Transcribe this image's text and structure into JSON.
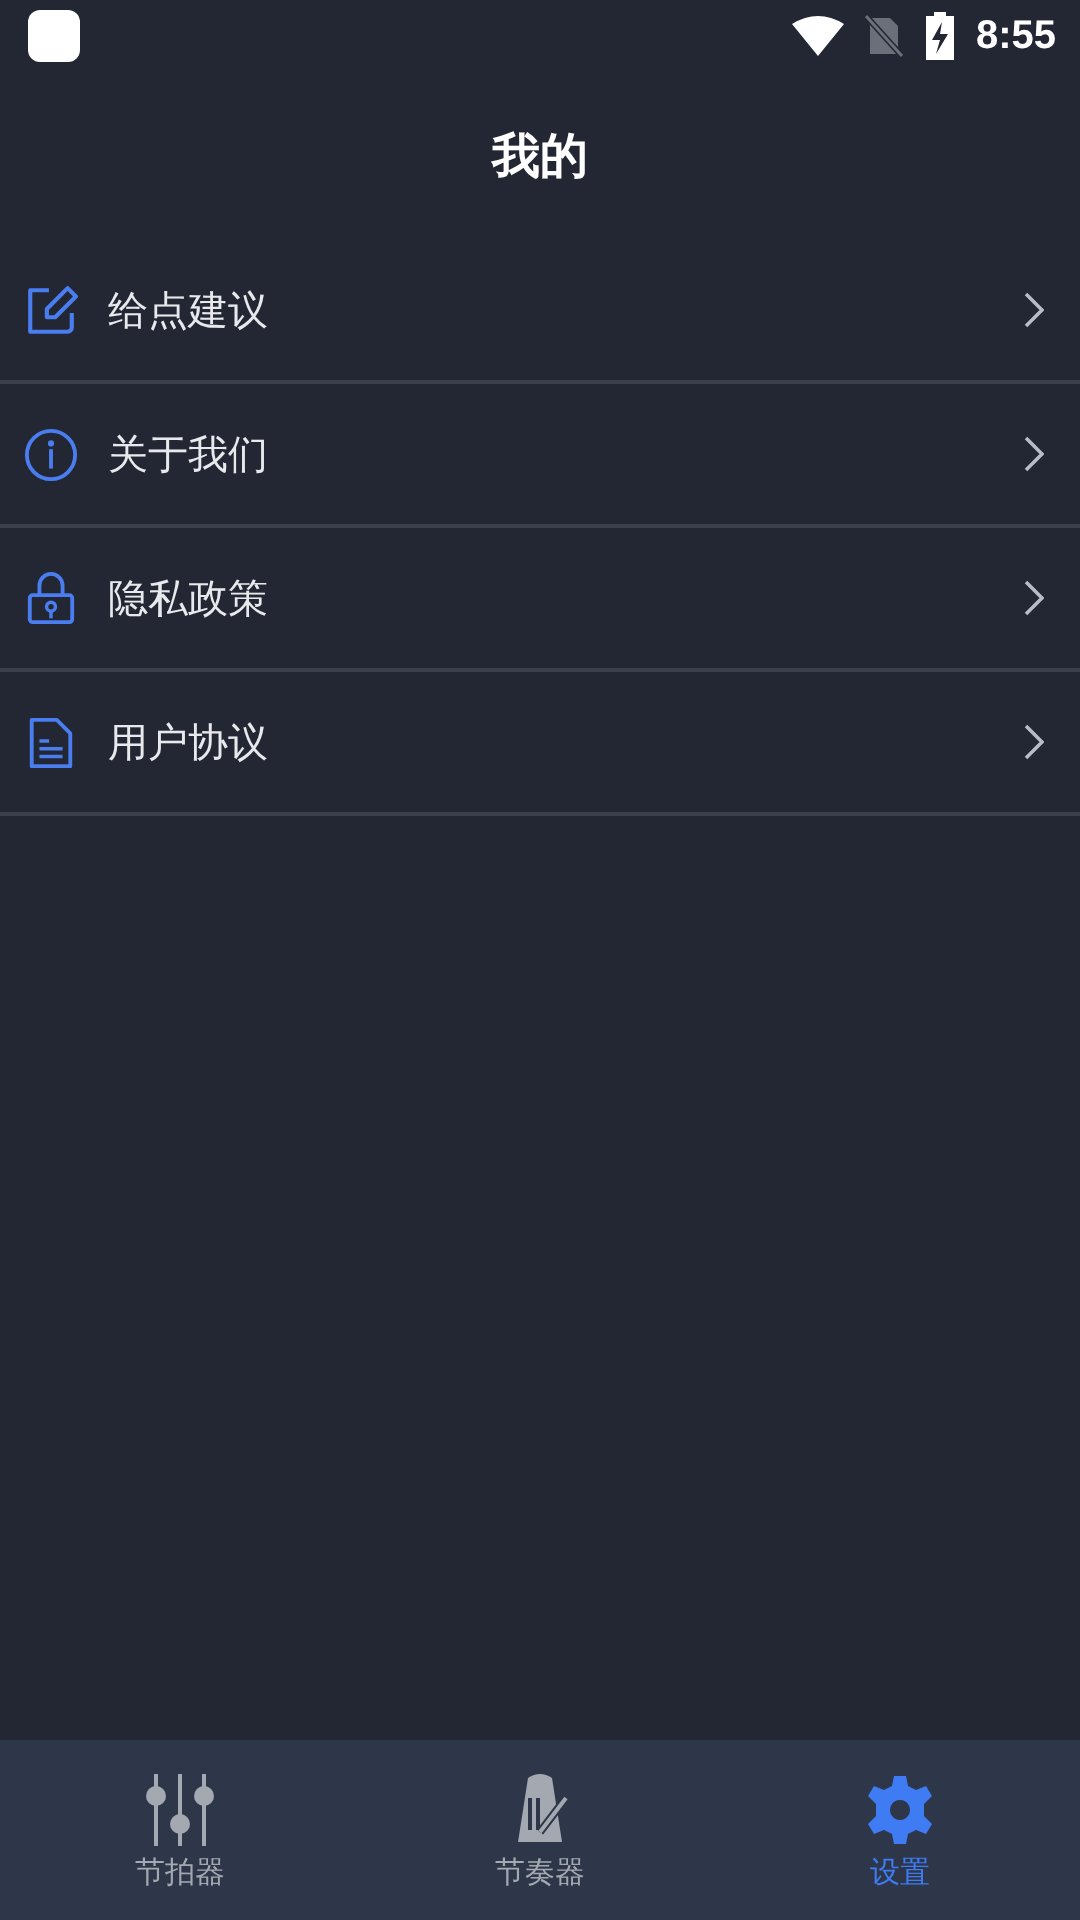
{
  "status_bar": {
    "time": "8:55"
  },
  "header": {
    "title": "我的"
  },
  "menu_items": [
    {
      "kind": "edit",
      "label": "给点建议"
    },
    {
      "kind": "info",
      "label": "关于我们"
    },
    {
      "kind": "lock",
      "label": "隐私政策"
    },
    {
      "kind": "document",
      "label": "用户协议"
    }
  ],
  "bottom_nav": [
    {
      "kind": "sliders",
      "label": "节拍器",
      "selected": false
    },
    {
      "kind": "metronome",
      "label": "节奏器",
      "selected": false
    },
    {
      "kind": "gear",
      "label": "设置",
      "selected": true
    }
  ]
}
